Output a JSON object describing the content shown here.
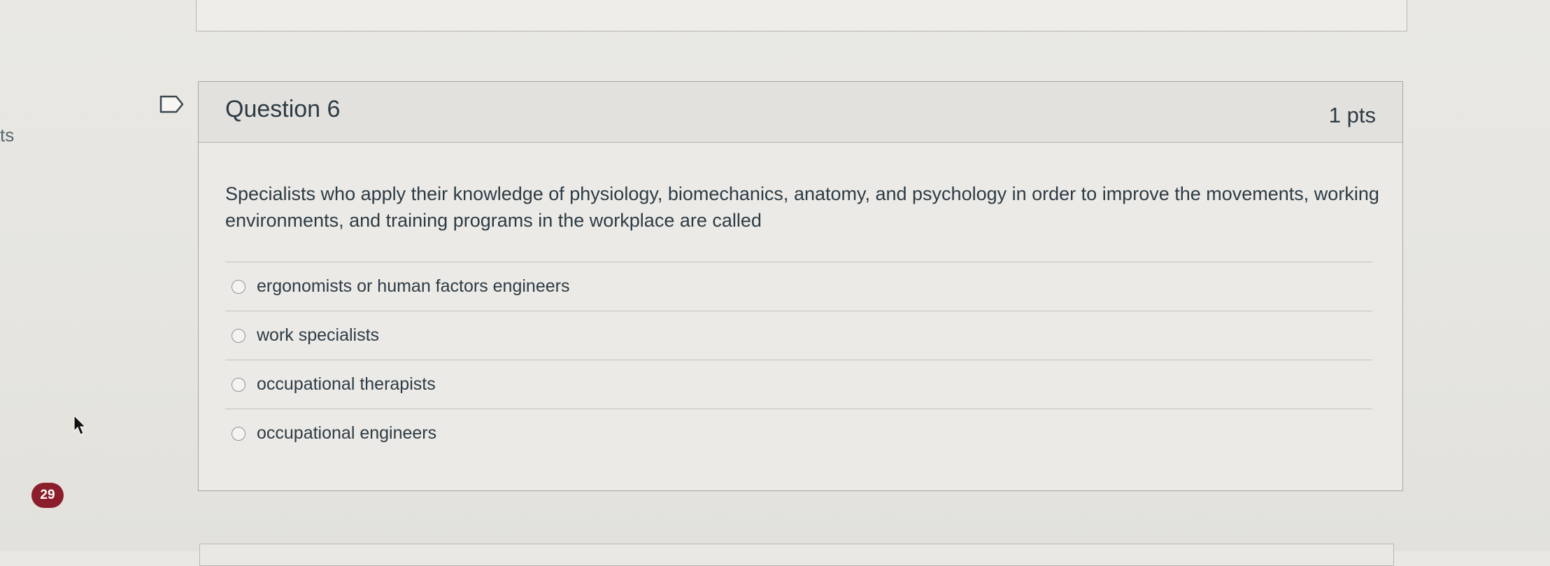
{
  "side": {
    "edge_text": "ts",
    "badge_count": "29"
  },
  "question": {
    "title": "Question 6",
    "points": "1 pts",
    "text": "Specialists who apply their knowledge of physiology, biomechanics, anatomy, and psychology in order to improve the movements, working environments, and training programs in the workplace are called",
    "answers": [
      {
        "label": "ergonomists or human factors engineers",
        "selected": false
      },
      {
        "label": "work specialists",
        "selected": false
      },
      {
        "label": "occupational therapists",
        "selected": false
      },
      {
        "label": "occupational engineers",
        "selected": false
      }
    ]
  },
  "icons": {
    "flag": "flag-outline-icon",
    "cursor": "mouse-pointer-icon"
  },
  "colors": {
    "badge": "#8c1d2a",
    "text": "#2d3b45",
    "header_bg": "#e2e1dd"
  }
}
